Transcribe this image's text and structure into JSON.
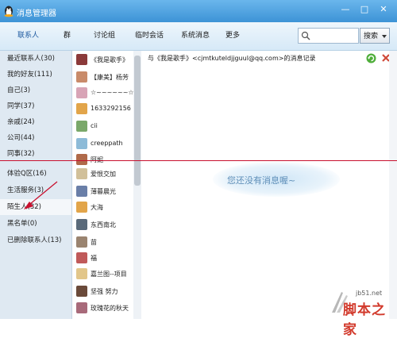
{
  "window": {
    "title": "消息管理器",
    "controls": [
      "—",
      "□",
      "✕"
    ]
  },
  "tabs": [
    {
      "label": "联系人",
      "active": true
    },
    {
      "label": "群",
      "active": false
    },
    {
      "label": "讨论组",
      "active": false
    },
    {
      "label": "临时会话",
      "active": false
    },
    {
      "label": "系统消息",
      "active": false
    },
    {
      "label": "更多",
      "active": false
    }
  ],
  "search": {
    "value": "",
    "placeholder": "",
    "button_label": "搜索"
  },
  "groups": [
    {
      "label": "最近联系人(30)"
    },
    {
      "label": "我的好友(111)"
    },
    {
      "label": "自己(3)"
    },
    {
      "label": "同学(37)"
    },
    {
      "label": "亲戚(24)"
    },
    {
      "label": "公司(44)"
    },
    {
      "label": "同事(32)"
    },
    {
      "label": "体验Q区(16)"
    },
    {
      "label": "生活服务(3)"
    },
    {
      "label": "陌生人(32)",
      "selected": true
    },
    {
      "label": "黑名单(0)"
    },
    {
      "label": "已删除联系人(13)"
    }
  ],
  "contacts": [
    {
      "name": "《我是歌手》",
      "avatar_color": "#8b3a3a"
    },
    {
      "name": "【康美】杨芳",
      "avatar_color": "#c98b6a"
    },
    {
      "name": "☆~~~~~~☆",
      "avatar_color": "#d8a4b6"
    },
    {
      "name": "1633292156",
      "avatar_color": "#e2a54a"
    },
    {
      "name": "cii",
      "avatar_color": "#7aa86a"
    },
    {
      "name": "creeppath",
      "avatar_color": "#8dbbd8"
    },
    {
      "name": "阿妮",
      "avatar_color": "#b06a4a"
    },
    {
      "name": "爱恨交加",
      "avatar_color": "#d1c09a"
    },
    {
      "name": "薄暮晨光",
      "avatar_color": "#6a7fa8"
    },
    {
      "name": "大海",
      "avatar_color": "#e2a54a"
    },
    {
      "name": "东西南北",
      "avatar_color": "#5a6a7a"
    },
    {
      "name": "苗",
      "avatar_color": "#9a8470"
    },
    {
      "name": "福",
      "avatar_color": "#c05a5a"
    },
    {
      "name": "嘉兰图--项目",
      "avatar_color": "#e2c68a"
    },
    {
      "name": "坚强 努力",
      "avatar_color": "#6a4a3a"
    },
    {
      "name": "玫瑰花的秋天",
      "avatar_color": "#a86a7a"
    }
  ],
  "message_panel": {
    "header": "与《我是歌手》<cjmtkuteldjjguul@qq.com>的消息记录",
    "empty_text": "您还没有消息喔~"
  },
  "watermark": {
    "url": "jb51.net",
    "text": "脚本之家"
  },
  "colors": {
    "titlebar": "#4aa3e2",
    "annotation_red": "#c8102e",
    "tab_active": "#1e5aa0"
  }
}
